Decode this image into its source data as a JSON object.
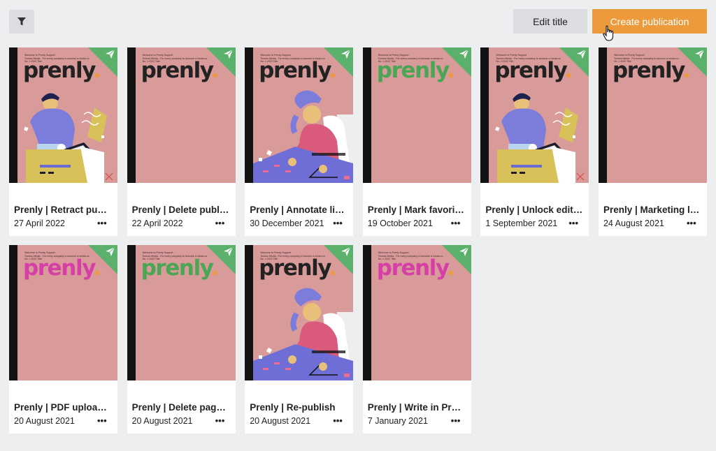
{
  "toolbar": {
    "filter_icon": "filter-icon",
    "edit_title_label": "Edit title",
    "create_publication_label": "Create publication"
  },
  "cover": {
    "brand": "prenly",
    "brand_dot": ".",
    "meta_line1": "Welcome to Prenly Support",
    "meta_line2": "Tonnes Media - For every company to become a media co",
    "meta_line3": "No. x 2022 Title",
    "corner_icon": "send-icon",
    "colors": {
      "bg": "#d99b9a",
      "spine": "#121212",
      "corner": "#5bb06b",
      "accent": "#ec9a3c"
    }
  },
  "publications": [
    {
      "title": "Prenly | Retract publication",
      "date": "27 April 2022",
      "brand_color": "#222222",
      "art": "box-person",
      "menu": "•••"
    },
    {
      "title": "Prenly | Delete publication",
      "date": "22 April 2022",
      "brand_color": "#222222",
      "art": "none",
      "menu": "•••"
    },
    {
      "title": "Prenly | Annotate links",
      "date": "30 December 2021",
      "brand_color": "#222222",
      "art": "desk-person",
      "menu": "•••"
    },
    {
      "title": "Prenly | Mark favorites",
      "date": "19 October 2021",
      "brand_color": "#4aa555",
      "art": "none",
      "menu": "•••"
    },
    {
      "title": "Prenly | Unlock edition",
      "date": "1 September 2021",
      "brand_color": "#222222",
      "art": "box-person",
      "menu": "•••"
    },
    {
      "title": "Prenly | Marketing link",
      "date": "24 August 2021",
      "brand_color": "#222222",
      "art": "none",
      "menu": "•••"
    },
    {
      "title": "Prenly | PDF upload issues",
      "date": "20 August 2021",
      "brand_color": "#d63fa6",
      "art": "none",
      "menu": "•••"
    },
    {
      "title": "Prenly | Delete page of edition",
      "date": "20 August 2021",
      "brand_color": "#4aa555",
      "art": "none",
      "menu": "•••"
    },
    {
      "title": "Prenly | Re-publish",
      "date": "20 August 2021",
      "brand_color": "#222222",
      "art": "desk-person",
      "menu": "•••"
    },
    {
      "title": "Prenly | Write in Prenly",
      "date": "7 January 2021",
      "brand_color": "#d63fa6",
      "art": "none",
      "menu": "•••"
    }
  ]
}
